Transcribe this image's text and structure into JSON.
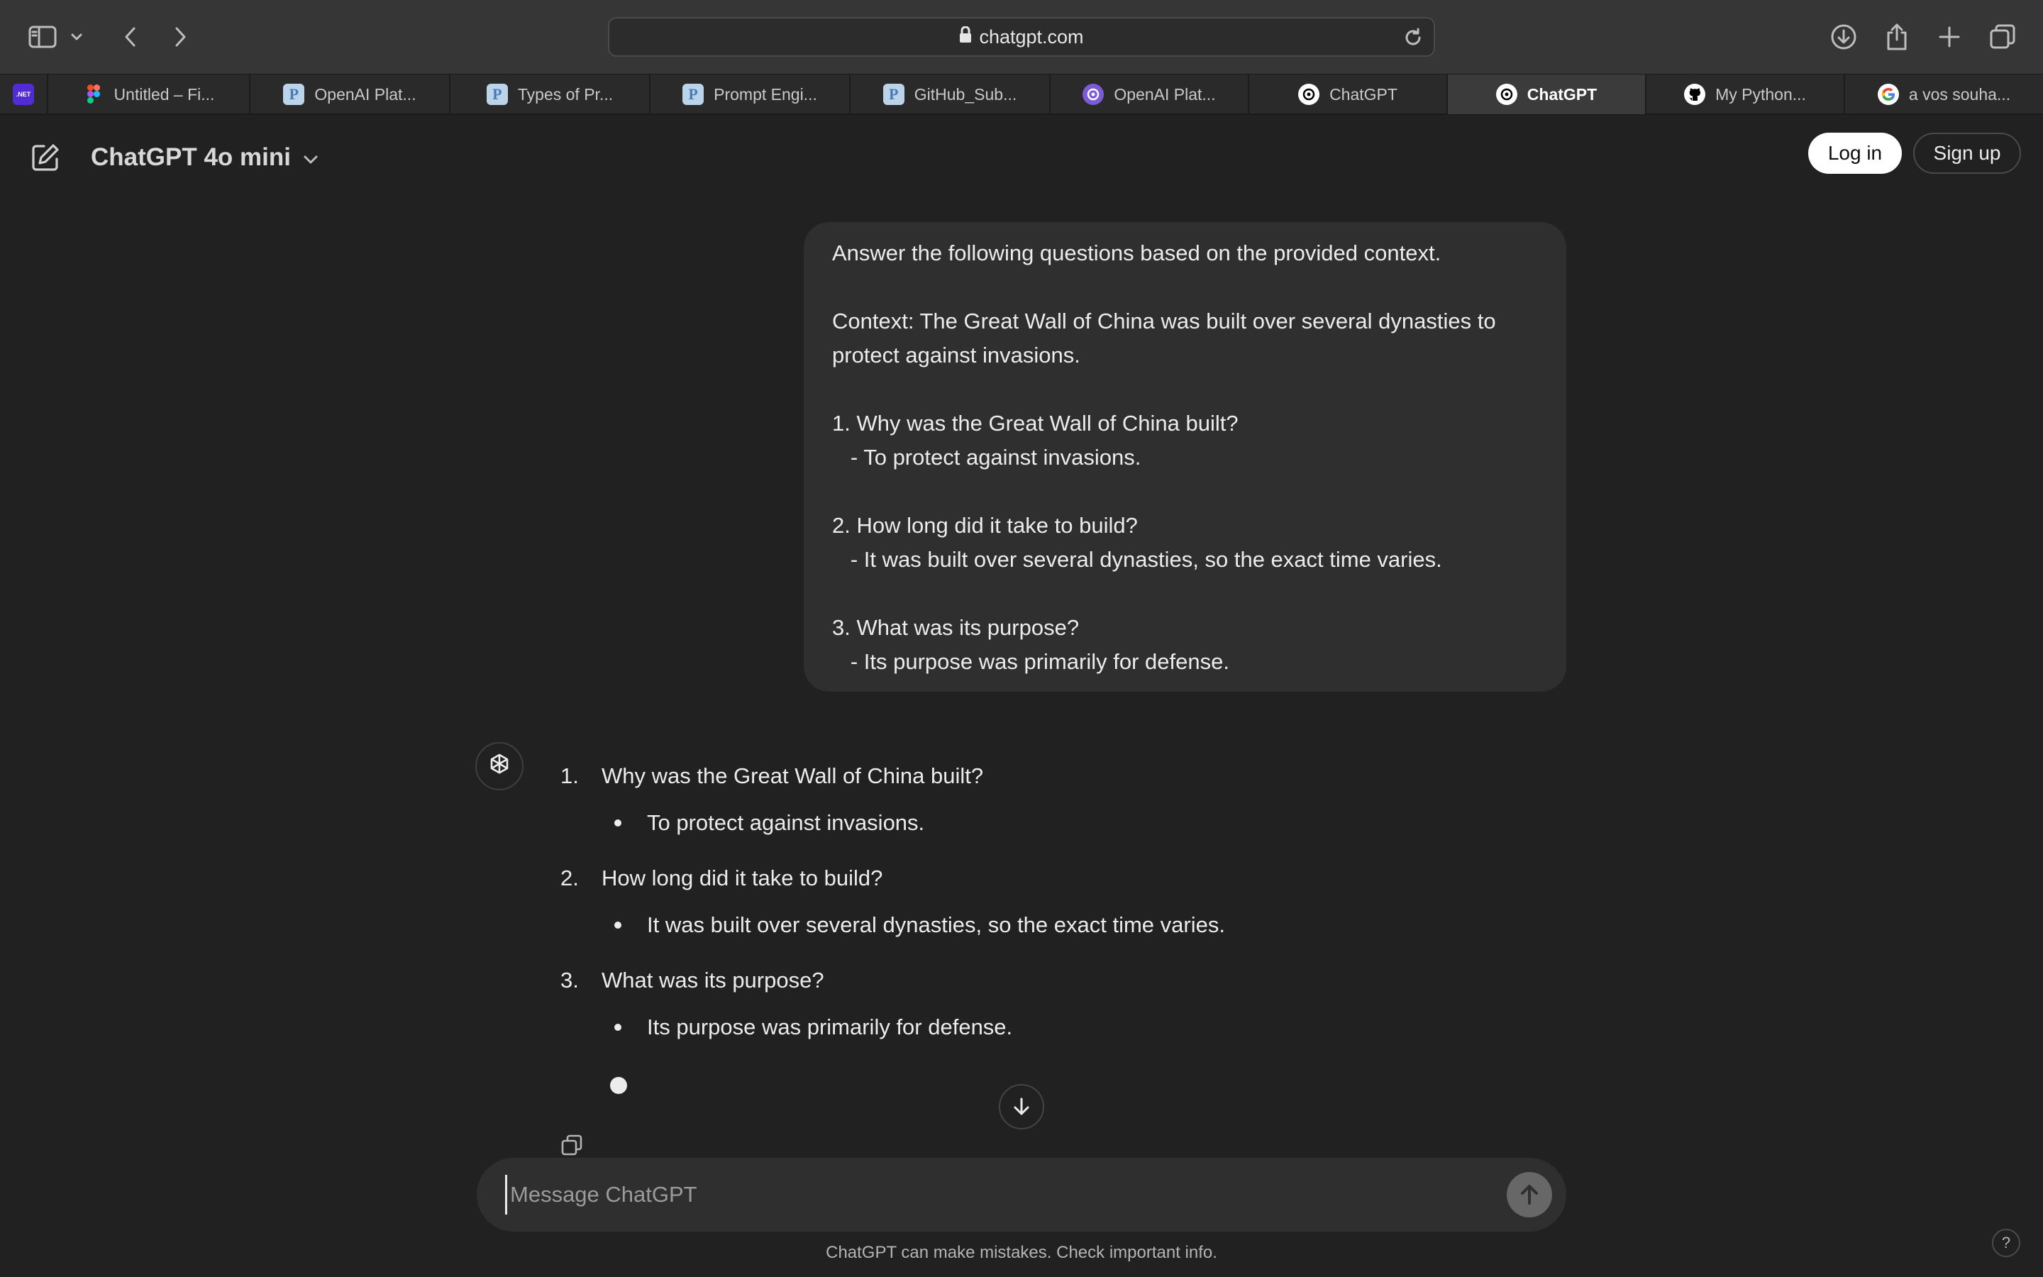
{
  "browser": {
    "url": "chatgpt.com",
    "tabs": [
      {
        "label": "",
        "icon": "dotnet-icon",
        "badge": ".NET"
      },
      {
        "label": "Untitled – Fi...",
        "icon": "figma-icon"
      },
      {
        "label": "OpenAI Plat...",
        "icon": "p-icon"
      },
      {
        "label": "Types of Pr...",
        "icon": "p-icon"
      },
      {
        "label": "Prompt Engi...",
        "icon": "p-icon"
      },
      {
        "label": "GitHub_Sub...",
        "icon": "p-icon"
      },
      {
        "label": "OpenAI Plat...",
        "icon": "openai-icon"
      },
      {
        "label": "ChatGPT",
        "icon": "openai-icon"
      },
      {
        "label": "ChatGPT",
        "icon": "openai-icon",
        "active": true
      },
      {
        "label": "My Python...",
        "icon": "github-icon"
      },
      {
        "label": "a vos souha...",
        "icon": "google-icon"
      }
    ]
  },
  "header": {
    "model": "ChatGPT 4o mini",
    "login_label": "Log in",
    "signup_label": "Sign up"
  },
  "user_message": {
    "lines": [
      "Answer the following questions based on the provided context.",
      "",
      "Context: The Great Wall of China was built over several dynasties to",
      "protect against invasions.",
      "",
      "1. Why was the Great Wall of China built?",
      "   - To protect against invasions.",
      "",
      "2. How long did it take to build?",
      "   - It was built over several dynasties, so the exact time varies.",
      "",
      "3. What was its purpose?",
      "   - Its purpose was primarily for defense."
    ]
  },
  "assistant_message": {
    "items": [
      {
        "num": "1.",
        "question": "Why was the Great Wall of China built?",
        "answer": "To protect against invasions."
      },
      {
        "num": "2.",
        "question": "How long did it take to build?",
        "answer": "It was built over several dynasties, so the exact time varies."
      },
      {
        "num": "3.",
        "question": "What was its purpose?",
        "answer": "Its purpose was primarily for defense."
      }
    ]
  },
  "composer": {
    "placeholder": "Message ChatGPT"
  },
  "footer": {
    "disclaimer": "ChatGPT can make mistakes. Check important info.",
    "help": "?"
  },
  "colors": {
    "background": "#212121",
    "bubble": "#2f2f2f",
    "browser_toolbar": "#363636",
    "text": "#ececec"
  }
}
